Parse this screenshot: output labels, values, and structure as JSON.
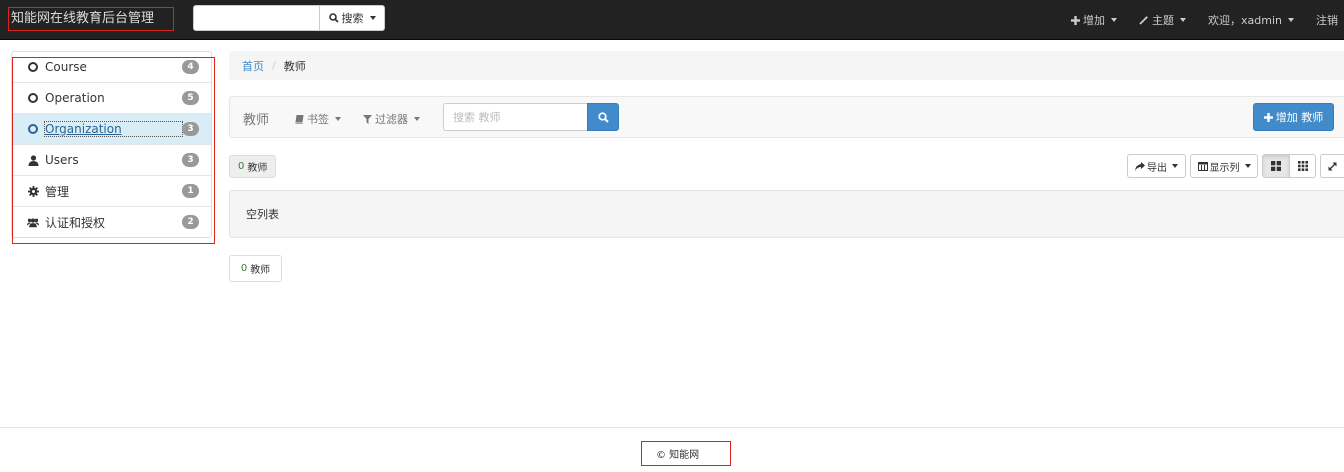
{
  "navbar": {
    "brand": "知能网在线教育后台管理",
    "search_button": "搜索",
    "items": [
      {
        "label": "增加",
        "icon": "plus-icon"
      },
      {
        "label": "主题",
        "icon": "magic-wand-icon"
      },
      {
        "label": "欢迎，xadmin",
        "icon": null
      },
      {
        "label": "注销",
        "icon": null
      }
    ]
  },
  "sidebar": {
    "items": [
      {
        "label": "Course",
        "count": "4",
        "icon": "circle-icon",
        "active": false
      },
      {
        "label": "Operation",
        "count": "5",
        "icon": "circle-icon",
        "active": false
      },
      {
        "label": "Organization",
        "count": "3",
        "icon": "circle-icon",
        "active": true
      },
      {
        "label": "Users",
        "count": "3",
        "icon": "user-icon",
        "active": false
      },
      {
        "label": "管理",
        "count": "1",
        "icon": "gear-icon",
        "active": false
      },
      {
        "label": "认证和授权",
        "count": "2",
        "icon": "group-icon",
        "active": false
      }
    ]
  },
  "breadcrumb": {
    "home": "首页",
    "separator": "/",
    "current": "教师"
  },
  "toolbar": {
    "title": "教师",
    "bookmarks": "书签",
    "filters": "过滤器",
    "search_placeholder": "搜索 教师",
    "add_button": "增加 教师"
  },
  "count": {
    "value": "0",
    "label": "教师"
  },
  "export": {
    "label": "导出"
  },
  "columns": {
    "label": "显示列"
  },
  "empty_list": "空列表",
  "footer": {
    "text": "© 知能网"
  },
  "colors": {
    "primary": "#428bca",
    "navbar_bg": "#222222",
    "highlight_border": "#d9261c",
    "active_item_bg": "#d9edf7"
  }
}
